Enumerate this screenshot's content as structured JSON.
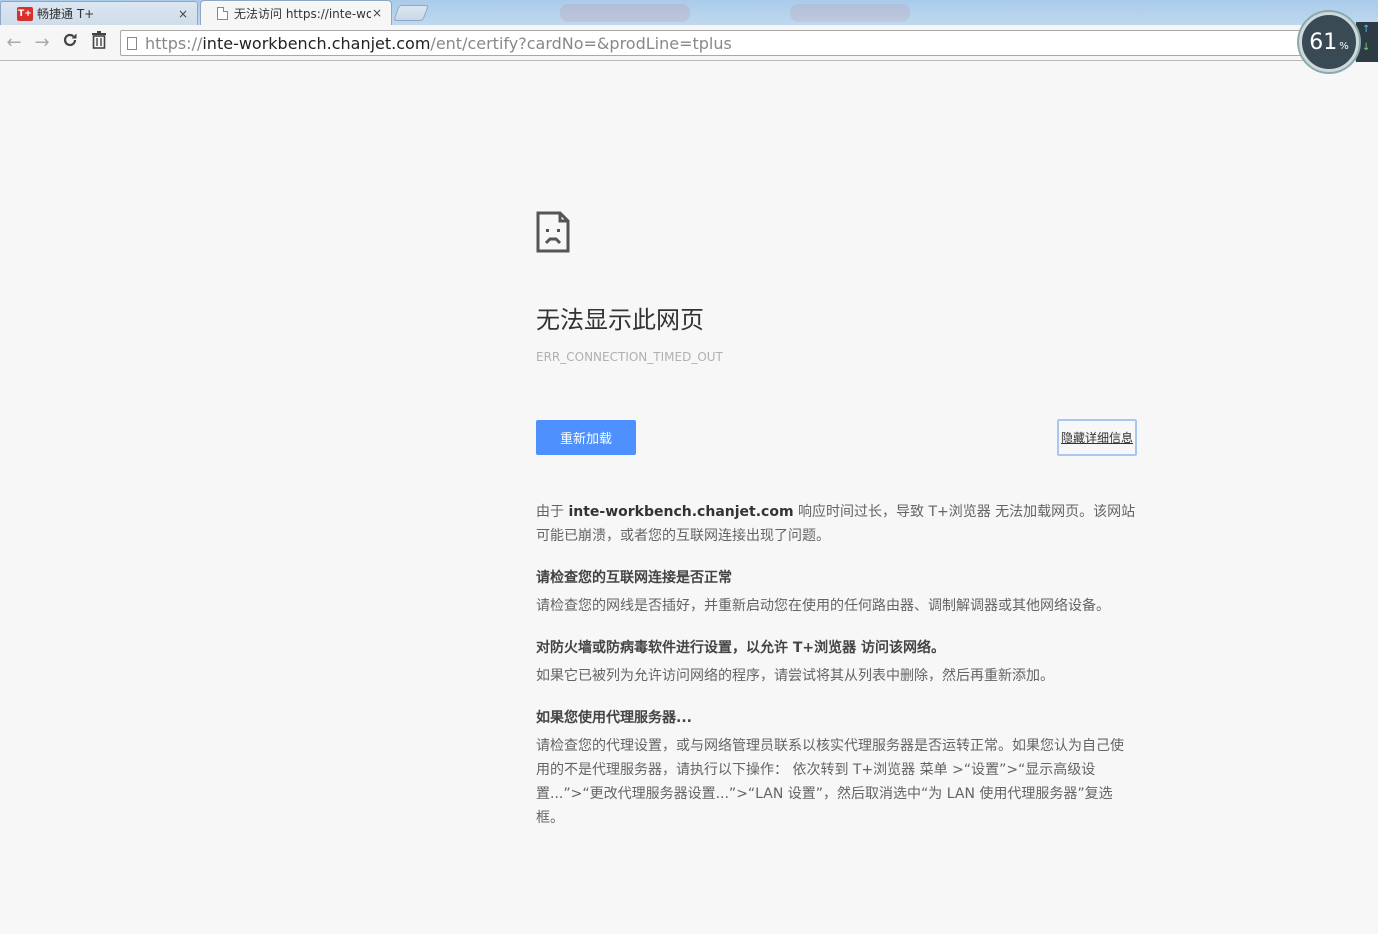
{
  "tabs": [
    {
      "label": "畅捷通 T+",
      "favicon": "T+",
      "close": "×"
    },
    {
      "label": "无法访问 https://inte-wo",
      "close": "×"
    }
  ],
  "toolbar": {
    "back_icon": "←",
    "forward_icon": "→",
    "reload_icon": "C",
    "trash_icon": "trash"
  },
  "omnibox": {
    "scheme": "https://",
    "host": "inte-workbench.chanjet.com",
    "path": "/ent/certify?cardNo=&prodLine=tplus"
  },
  "speed_widget": {
    "value": "61",
    "unit": "%",
    "up": "↑",
    "down": "↓"
  },
  "error": {
    "title": "无法显示此网页",
    "code": "ERR_CONNECTION_TIMED_OUT",
    "reload_label": "重新加载",
    "details_label": "隐藏详细信息",
    "summary_pre": "由于 ",
    "summary_host": "inte-workbench.chanjet.com",
    "summary_post": " 响应时间过长，导致 T+浏览器 无法加载网页。该网站可能已崩溃，或者您的互联网连接出现了问题。",
    "sections": [
      {
        "heading": "请检查您的互联网连接是否正常",
        "body": "请检查您的网线是否插好，并重新启动您在使用的任何路由器、调制解调器或其他网络设备。"
      },
      {
        "heading": "对防火墙或防病毒软件进行设置，以允许 T+浏览器 访问该网络。",
        "body": "如果它已被列为允许访问网络的程序，请尝试将其从列表中删除，然后再重新添加。"
      },
      {
        "heading": "如果您使用代理服务器...",
        "body": "请检查您的代理设置，或与网络管理员联系以核实代理服务器是否运转正常。如果您认为自己使用的不是代理服务器，请执行以下操作： 依次转到 T+浏览器 菜单 >“设置”>“显示高级设置...”>“更改代理服务器设置...”>“LAN 设置”，然后取消选中“为 LAN 使用代理服务器”复选框。"
      }
    ]
  }
}
